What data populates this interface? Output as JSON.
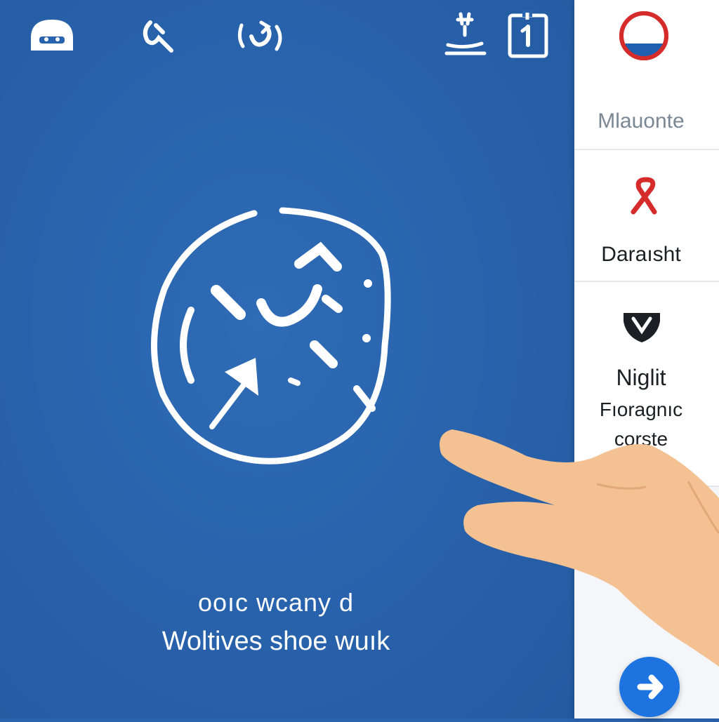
{
  "main": {
    "background_color": "#2a63ad",
    "toolbar": [
      {
        "name": "cloud-dashboard-icon"
      },
      {
        "name": "swipe-gesture-icon"
      },
      {
        "name": "refresh-gesture-icon"
      },
      {
        "name": "anchor-settings-icon"
      },
      {
        "name": "document-info-icon"
      }
    ],
    "hero_icon": "globe-arrow-icon",
    "caption_line1": "ooıc wcany d",
    "caption_line2": "Woltives shoe wuık"
  },
  "panel": {
    "items": [
      {
        "label": "Mlauonte",
        "icon": "half-filled-circle-icon",
        "icon_color": "#d62b2b",
        "fill_color": "#1f5fb0"
      },
      {
        "label": "Daraısht",
        "icon": "red-ribbon-icon",
        "icon_color": "#d62b2b"
      },
      {
        "label": "Niglit",
        "sublabel_1": "Fıoragnıc",
        "sublabel_2": "corste",
        "icon": "shield-icon",
        "icon_color": "#1d1f24"
      }
    ],
    "fab_icon": "play-arrow-icon",
    "fab_color": "#1d74e0"
  }
}
